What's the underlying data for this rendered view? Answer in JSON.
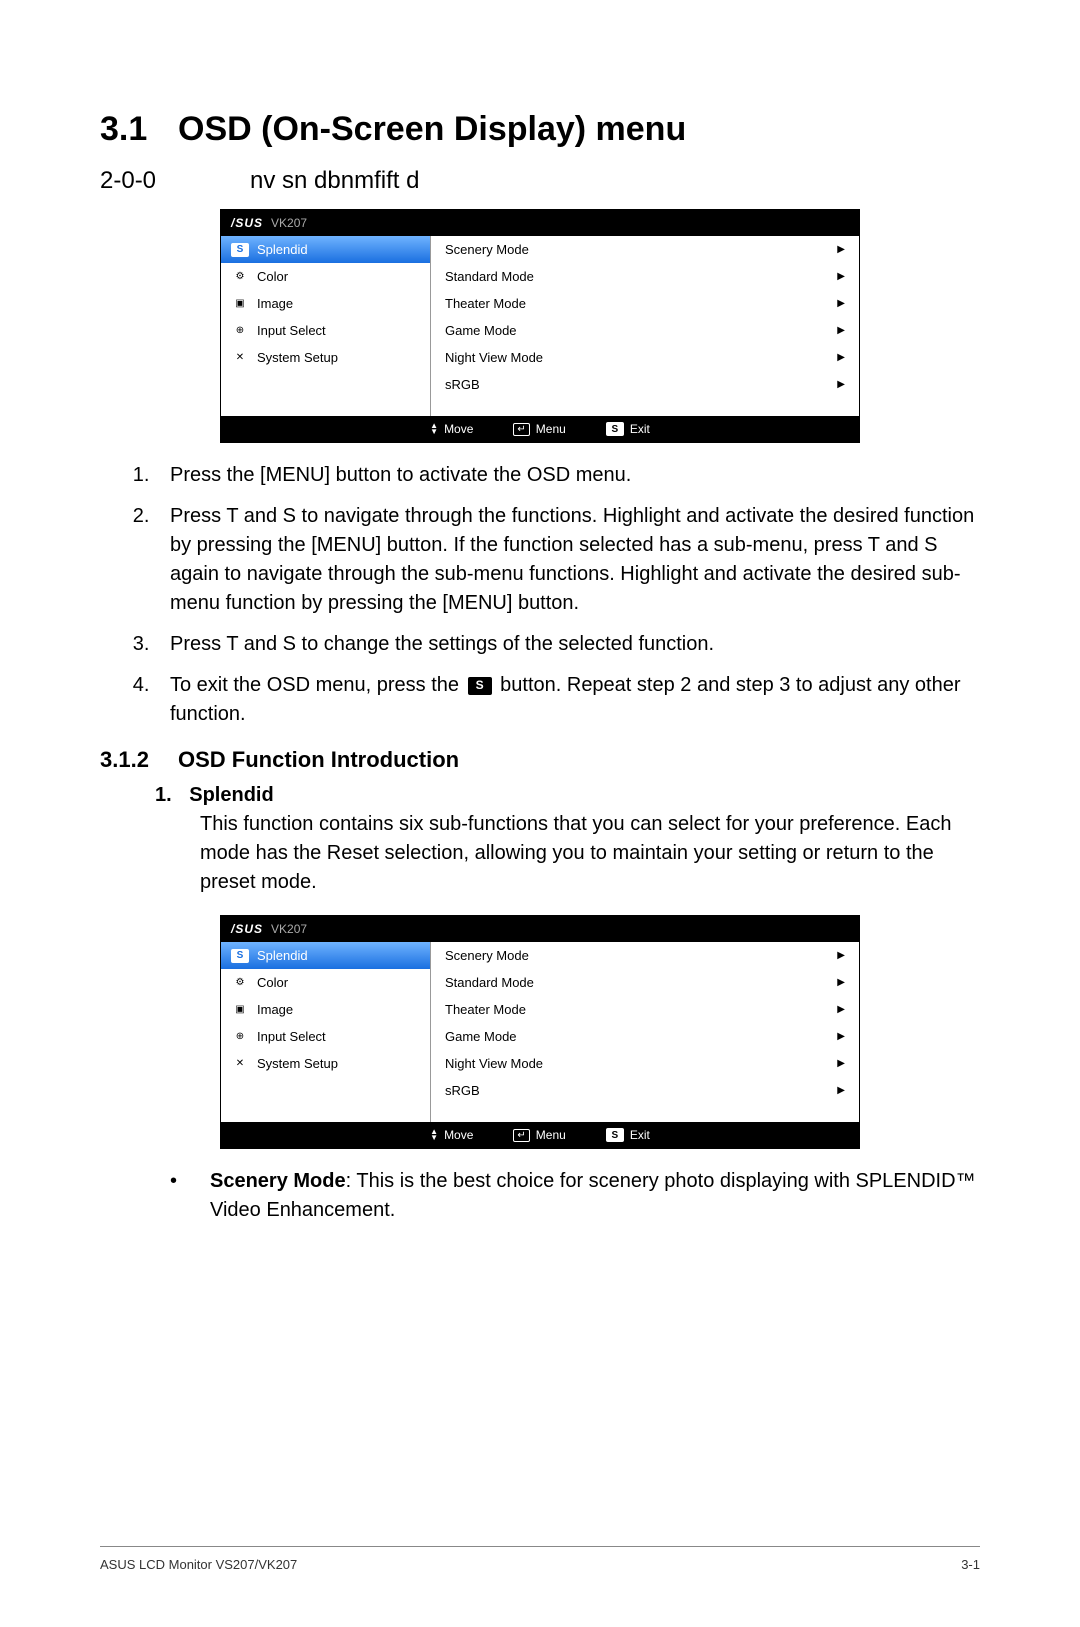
{
  "headings": {
    "h1_num": "3.1",
    "h1_text": "OSD (On-Screen Display) menu",
    "h2_num": "2-0-0",
    "h2_text": "nv  sn    dbnmﬁft  d",
    "h3_num": "3.1.2",
    "h3_text": "OSD Function Introduction"
  },
  "osd": {
    "brand": "/SUS",
    "model": "VK207",
    "left": [
      {
        "icon": "s",
        "label": "Splendid",
        "selected": true
      },
      {
        "icon": "color",
        "label": "Color"
      },
      {
        "icon": "image",
        "label": "Image"
      },
      {
        "icon": "input",
        "label": "Input Select"
      },
      {
        "icon": "setup",
        "label": "System Setup"
      }
    ],
    "right": [
      "Scenery Mode",
      "Standard Mode",
      "Theater Mode",
      "Game Mode",
      "Night View Mode",
      "sRGB"
    ],
    "footer": {
      "move": "Move",
      "menu": "Menu",
      "exit": "Exit"
    }
  },
  "steps": [
    "Press the [MENU] button to activate the OSD menu.",
    "Press  T and  S to navigate through the functions. Highlight and activate the desired function by pressing the [MENU] button. If the function selected has a sub-menu, press  T and  S again to navigate through the sub-menu functions. Highlight and activate the desired sub-menu function by pressing the [MENU] button.",
    "Press  T and  S to change the settings of the selected function.",
    "__STEP4__"
  ],
  "step4_parts": {
    "before": "To exit the OSD menu, press the ",
    "after": " button. Repeat step 2 and step 3 to adjust any other function."
  },
  "splendid": {
    "title_num": "1.",
    "title": "Splendid",
    "desc": "This function contains six sub-functions that you can select for your preference. Each mode has the Reset selection, allowing you to maintain your setting or return to the preset mode."
  },
  "bullet": {
    "marker": "•",
    "bold": "Scenery Mode",
    "rest": ": This is the best choice for scenery photo displaying with SPLENDID™ Video Enhancement."
  },
  "footer": {
    "left": "ASUS LCD Monitor VS207/VK207",
    "right": "3-1"
  }
}
